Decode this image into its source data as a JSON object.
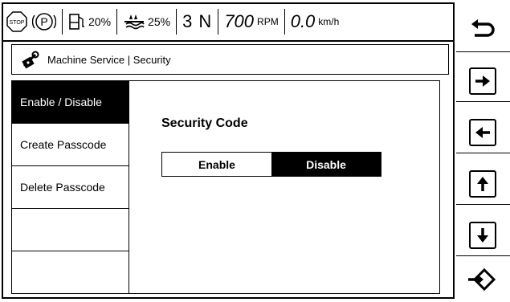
{
  "status_bar": {
    "stop_label": "STOP",
    "parking_label": "P",
    "fuel_percent": "20%",
    "def_percent": "25%",
    "gear": "3 N",
    "rpm_value": "700",
    "rpm_unit": "RPM",
    "speed_value": "0.0",
    "speed_unit": "km/h"
  },
  "breadcrumb": {
    "text": "Machine Service | Security",
    "icon": "lock-wrench-icon"
  },
  "menu": {
    "items": [
      {
        "label": "Enable / Disable",
        "active": true
      },
      {
        "label": "Create Passcode",
        "active": false
      },
      {
        "label": "Delete Passcode",
        "active": false
      },
      {
        "label": "",
        "active": false
      },
      {
        "label": "",
        "active": false
      }
    ]
  },
  "panel": {
    "title": "Security Code",
    "enable_label": "Enable",
    "disable_label": "Disable",
    "selected": "Disable"
  },
  "softkeys": [
    {
      "icon": "back-icon"
    },
    {
      "icon": "arrow-right-icon"
    },
    {
      "icon": "arrow-left-icon"
    },
    {
      "icon": "arrow-up-icon"
    },
    {
      "icon": "arrow-down-icon"
    },
    {
      "icon": "enter-icon"
    }
  ]
}
